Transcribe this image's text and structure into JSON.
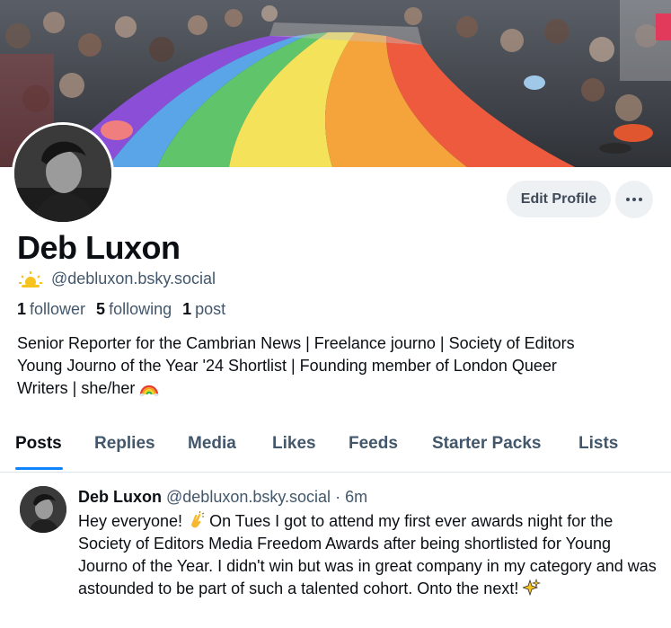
{
  "profile": {
    "display_name": "Deb Luxon",
    "handle": "@debluxon.bsky.social",
    "stats": {
      "followers_count": "1",
      "followers_label": "follower",
      "following_count": "5",
      "following_label": "following",
      "posts_count": "1",
      "posts_label": "post"
    },
    "bio_line1": "Senior Reporter for the Cambrian News | Freelance journo | Society of Editors",
    "bio_line2": "Young Journo of the Year '24 Shortlist | Founding member of London Queer",
    "bio_line3": "Writers | she/her"
  },
  "actions": {
    "edit_profile_label": "Edit Profile"
  },
  "tabs": [
    {
      "label": "Posts",
      "active": true
    },
    {
      "label": "Replies",
      "active": false
    },
    {
      "label": "Media",
      "active": false
    },
    {
      "label": "Likes",
      "active": false
    },
    {
      "label": "Feeds",
      "active": false
    },
    {
      "label": "Starter Packs",
      "active": false
    },
    {
      "label": "Lists",
      "active": false
    }
  ],
  "post": {
    "author": "Deb Luxon",
    "handle": "@debluxon.bsky.social",
    "separator": " · ",
    "time": "6m",
    "text_part1": "Hey everyone! ",
    "text_part2": " On Tues I got to attend my first ever awards night for the Society of Editors Media Freedom Awards after being shortlisted for Young Journo of the Year. I didn't win but was in great company in my category and was astounded to be part of such a talented cohort. Onto the next! "
  },
  "colors": {
    "accent": "#1083fe",
    "muted_text": "#42576c",
    "button_bg": "#eef1f4",
    "divider": "#dde3ea"
  },
  "icons": {
    "handle_emoji": "sun-behind-cloud-emoji",
    "bio_emoji": "rainbow-emoji",
    "post_emoji_1": "clapping-hands-emoji",
    "post_emoji_2": "sparkles-emoji",
    "more": "ellipsis-icon"
  }
}
